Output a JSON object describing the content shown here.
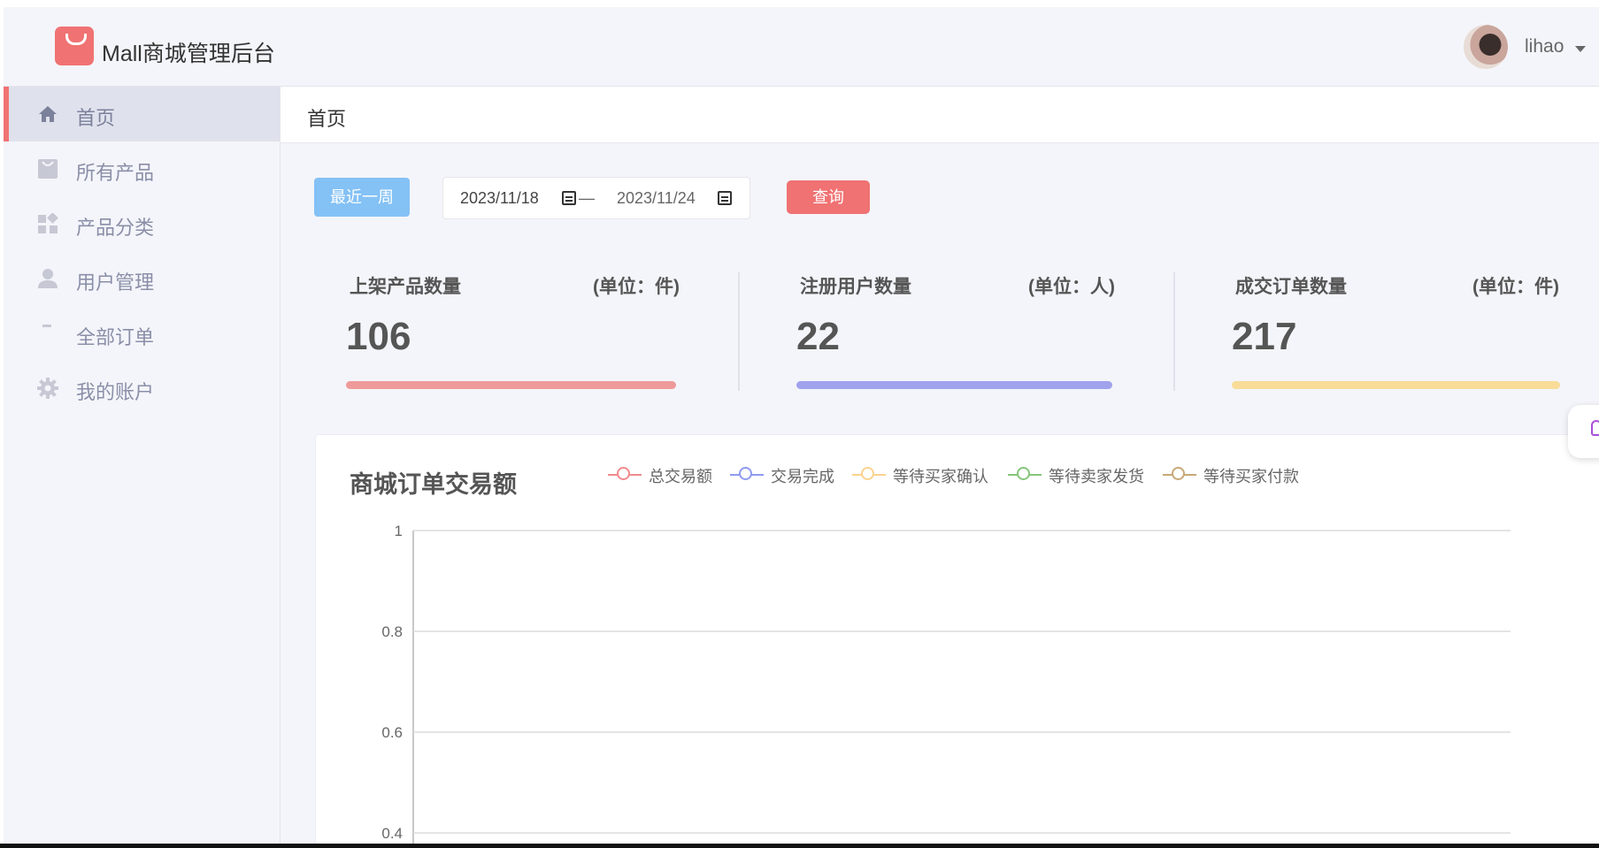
{
  "header": {
    "app_title": "Mall商城管理后台",
    "username": "lihao"
  },
  "sidebar": {
    "items": [
      {
        "label": "首页",
        "icon": "home-icon",
        "active": true
      },
      {
        "label": "所有产品",
        "icon": "bag-icon",
        "active": false
      },
      {
        "label": "产品分类",
        "icon": "category-icon",
        "active": false
      },
      {
        "label": "用户管理",
        "icon": "user-icon",
        "active": false
      },
      {
        "label": "全部订单",
        "icon": "order-icon",
        "active": false
      },
      {
        "label": "我的账户",
        "icon": "gear-icon",
        "active": false
      }
    ]
  },
  "page": {
    "title": "首页"
  },
  "filters": {
    "recent_week_label": "最近一周",
    "date_start": "2023/11/18",
    "date_separator": "—",
    "date_end": "2023/11/24",
    "query_label": "查询"
  },
  "stats": [
    {
      "label": "上架产品数量",
      "unit": "(单位：件)",
      "value": "106",
      "color": "#ef9a9a"
    },
    {
      "label": "注册用户数量",
      "unit": "(单位：人)",
      "value": "22",
      "color": "#a0a2ec"
    },
    {
      "label": "成交订单数量",
      "unit": "(单位：件)",
      "value": "217",
      "color": "#f8dc98"
    }
  ],
  "chart_data": {
    "type": "line",
    "title": "商城订单交易额",
    "series": [
      {
        "name": "总交易额",
        "color": "#f08a8c",
        "values": []
      },
      {
        "name": "交易完成",
        "color": "#8f9bf0",
        "values": []
      },
      {
        "name": "等待买家确认",
        "color": "#fbd38e",
        "values": []
      },
      {
        "name": "等待卖家发货",
        "color": "#86c57a",
        "values": []
      },
      {
        "name": "等待买家付款",
        "color": "#c9a876",
        "values": []
      }
    ],
    "y_ticks": [
      "1",
      "0.8",
      "0.6",
      "0.4"
    ],
    "ylim": [
      0.4,
      1
    ],
    "grid": true,
    "legend": "top"
  }
}
